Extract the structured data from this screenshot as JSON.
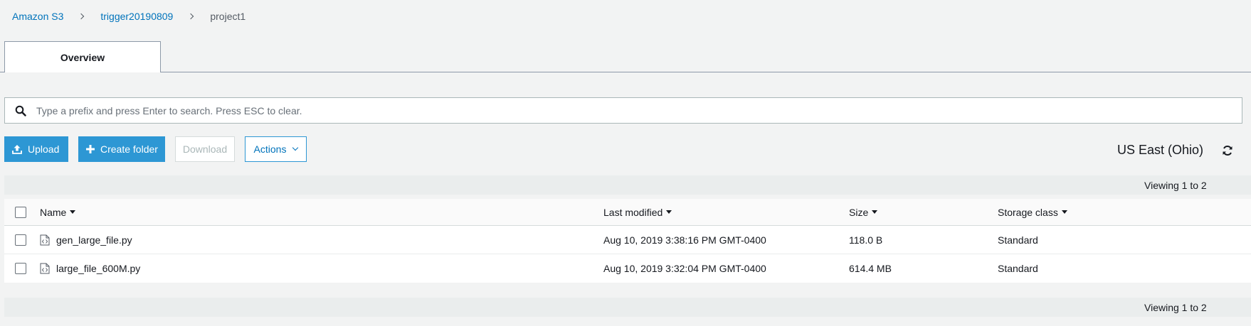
{
  "breadcrumb": {
    "root": "Amazon S3",
    "bucket": "trigger20190809",
    "folder": "project1"
  },
  "tabs": [
    {
      "label": "Overview"
    }
  ],
  "search": {
    "placeholder": "Type a prefix and press Enter to search. Press ESC to clear.",
    "value": ""
  },
  "toolbar": {
    "upload": "Upload",
    "create_folder": "Create folder",
    "download": "Download",
    "actions": "Actions"
  },
  "region": "US East (Ohio)",
  "viewing": "Viewing 1 to 2",
  "table": {
    "columns": [
      "Name",
      "Last modified",
      "Size",
      "Storage class"
    ],
    "rows": [
      {
        "name": "gen_large_file.py",
        "modified": "Aug 10, 2019 3:38:16 PM GMT-0400",
        "size": "118.0 B",
        "storage": "Standard"
      },
      {
        "name": "large_file_600M.py",
        "modified": "Aug 10, 2019 3:32:04 PM GMT-0400",
        "size": "614.4 MB",
        "storage": "Standard"
      }
    ]
  },
  "colors": {
    "primary": "#2d97d4",
    "link": "#0073bb",
    "background": "#f2f3f3"
  },
  "icons": [
    "search-icon",
    "upload-icon",
    "plus-icon",
    "chevron-down-icon",
    "refresh-icon",
    "file-code-icon",
    "sort-caret-icon",
    "breadcrumb-separator-icon"
  ]
}
